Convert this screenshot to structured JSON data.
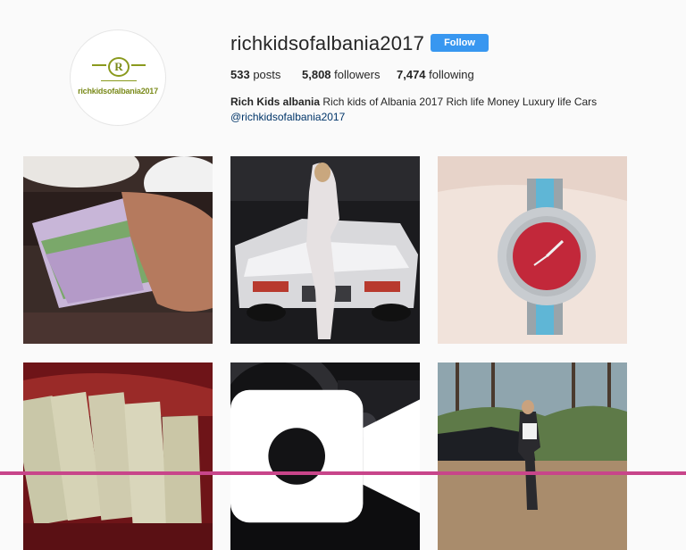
{
  "profile": {
    "username": "richkidsofalbania2017",
    "follow_label": "Follow",
    "avatar_text": "richkidsofalbania2017",
    "avatar_letter": "R"
  },
  "stats": {
    "posts_count": "533",
    "posts_label": " posts",
    "followers_count": "5,808",
    "followers_label": " followers",
    "following_count": "7,474",
    "following_label": " following"
  },
  "bio": {
    "name": "Rich Kids albania",
    "text": " Rich kids of Albania 2017 Rich life Money Luxury life Cars",
    "handle": "@richkidsofalbania2017"
  },
  "posts": [
    {
      "subject": "hand-holding-euro-banknotes"
    },
    {
      "subject": "woman-with-white-lamborghini"
    },
    {
      "subject": "rolex-watch-red-dial"
    },
    {
      "subject": "stacks-of-dollar-bundles"
    },
    {
      "subject": "car-steering-wheel-interior",
      "is_video": true
    },
    {
      "subject": "woman-beside-dark-car-in-forest"
    }
  ],
  "colors": {
    "accent": "#3897f0",
    "link": "#003569",
    "logo": "#8a9a1e",
    "background": "#fafafa"
  }
}
